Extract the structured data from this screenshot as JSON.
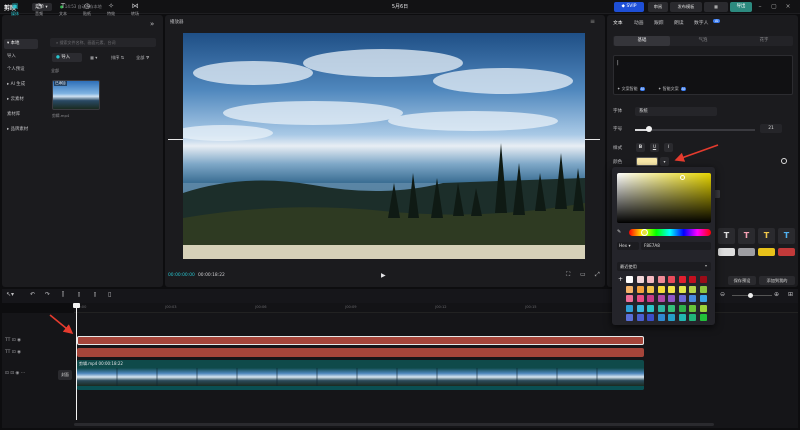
{
  "topbar": {
    "logo": "剪映",
    "menu_label": "菜单",
    "autosave": "14:53 自动保存本地",
    "doc_title": "5月6日",
    "svip_label": "SVIP",
    "share_label": "审阅",
    "publish_label": "发布模板",
    "export_label": "导出"
  },
  "left_panel": {
    "tabs": [
      {
        "label": "媒体",
        "icon": "media-icon"
      },
      {
        "label": "音频",
        "icon": "audio-icon"
      },
      {
        "label": "文本",
        "icon": "text-icon"
      },
      {
        "label": "贴纸",
        "icon": "sticker-icon"
      },
      {
        "label": "特效",
        "icon": "effect-icon"
      },
      {
        "label": "转场",
        "icon": "transition-icon"
      }
    ],
    "side_items": [
      "本地",
      "导入",
      "个人预设",
      "AI 生成",
      "云素材",
      "素材库",
      "品牌素材"
    ],
    "search_placeholder": "搜索文件名称、画面元素、台词",
    "import_label": "导入",
    "sort_label": "排序",
    "filter_label": "全部",
    "all_label": "全部",
    "thumb_tag": "已添加",
    "thumb_name": "剪辑.mp4"
  },
  "player": {
    "title": "播放器",
    "current_time": "00:00:00:00",
    "duration": "00:00:18:22"
  },
  "right_panel": {
    "tabs": [
      "文本",
      "动画",
      "跟踪",
      "朗读",
      "数字人"
    ],
    "badge": "AI",
    "sub_tabs": [
      "基础",
      "气泡",
      "花字"
    ],
    "text_option_1": "文案智能",
    "text_option_2": "智能文案",
    "text_badge": "AI",
    "font_label": "字体",
    "font_value": "系统",
    "size_label": "字号",
    "size_value": "21",
    "style_label": "样式",
    "style_buttons": [
      "B",
      "U",
      "I"
    ],
    "color_label": "颜色",
    "save_preset": "保存预设",
    "add_preset": "添加到我的",
    "preset_glyph": "T"
  },
  "color_picker": {
    "mode": "Hex",
    "hex": "F8E7A8",
    "recent_label": "最近使用",
    "add_glyph": "+",
    "swatches": [
      [
        "#ffffff",
        "#f2d7d9",
        "#f4b9c0",
        "#f08a96",
        "#e94b5b",
        "#e21f2f",
        "#c3101f",
        "#9a0c18"
      ],
      [
        "#f5b46a",
        "#f3a03c",
        "#f2c34a",
        "#f5dc3a",
        "#f0e64a",
        "#e0e84a",
        "#b7d64a",
        "#8cc63f"
      ],
      [
        "#ef6f9a",
        "#e94b86",
        "#c73a8a",
        "#b14aa8",
        "#8e58c8",
        "#6c6bd8",
        "#4a8be0",
        "#3aa6e8"
      ],
      [
        "#2fa0d8",
        "#3bb7e0",
        "#2cc4c9",
        "#2fb7a2",
        "#35c17a",
        "#2fb24c",
        "#67c43a",
        "#9bd43a"
      ],
      [
        "#5a6fd8",
        "#4a5fd0",
        "#3a4ec8",
        "#2f8ad0",
        "#26a0c8",
        "#23b6b0",
        "#21b47a",
        "#22c03a"
      ]
    ]
  },
  "timeline": {
    "ticks": [
      "00:00",
      "|00:03",
      "|00:06",
      "|00:09",
      "|00:12",
      "|00:15",
      "|00:18"
    ],
    "cover_label": "封面",
    "clip_label": "剪辑.mp4  00:00:18:22"
  }
}
